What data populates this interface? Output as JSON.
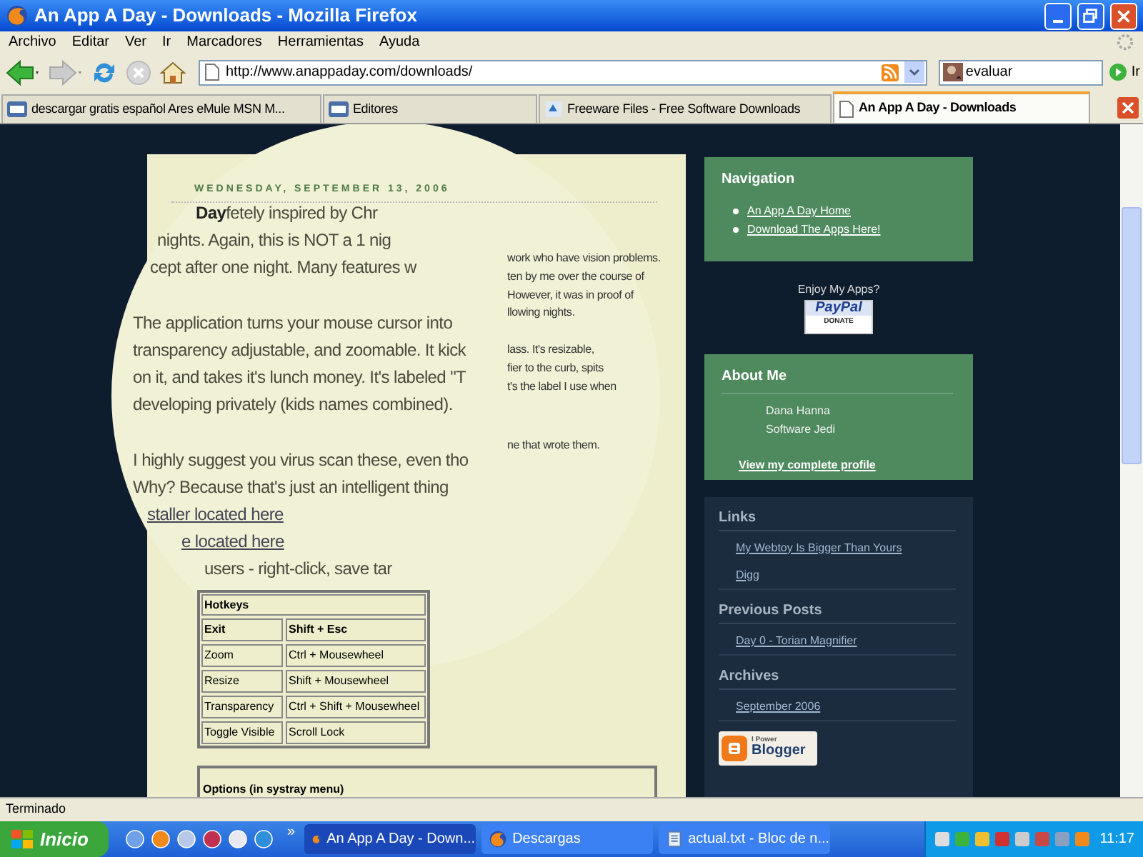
{
  "window": {
    "title": "An App A Day - Downloads - Mozilla Firefox"
  },
  "menu": [
    "Archivo",
    "Editar",
    "Ver",
    "Ir",
    "Marcadores",
    "Herramientas",
    "Ayuda"
  ],
  "toolbar": {
    "url": "http://www.anappaday.com/downloads/",
    "search_value": "evaluar",
    "go_label": "Ir"
  },
  "tabs": [
    {
      "label": "descargar gratis español Ares eMule MSN M...",
      "selected": false
    },
    {
      "label": "Editores",
      "selected": false
    },
    {
      "label": "Freeware Files - Free Software Downloads",
      "selected": false
    },
    {
      "label": "An App A Day - Downloads",
      "selected": true
    }
  ],
  "post": {
    "date": "WEDNESDAY, SEPTEMBER 13, 2006",
    "magnified_lines": [
      {
        "parts": [
          {
            "kind": "bold",
            "text": "Day"
          },
          {
            "kind": "text",
            "text": "fetely inspired by Chr"
          }
        ]
      },
      {
        "parts": [
          {
            "kind": "text",
            "text": "nights. Again, this is NOT a 1 nig"
          }
        ]
      },
      {
        "parts": [
          {
            "kind": "text",
            "text": "cept after one night. Many features w"
          }
        ]
      },
      {
        "parts": [
          {
            "kind": "text",
            "text": "The application turns your mouse cursor into"
          }
        ]
      },
      {
        "parts": [
          {
            "kind": "text",
            "text": "transparency adjustable, and zoomable. It kick"
          }
        ]
      },
      {
        "parts": [
          {
            "kind": "text",
            "text": "on it, and takes it's lunch money. It's labeled \"T"
          }
        ]
      },
      {
        "parts": [
          {
            "kind": "text",
            "text": "developing privately (kids names combined)."
          }
        ]
      },
      {
        "parts": [
          {
            "kind": "text",
            "text": "I highly suggest you virus scan these, even tho"
          }
        ]
      },
      {
        "parts": [
          {
            "kind": "text",
            "text": "Why? Because that's just an intelligent thing"
          }
        ]
      },
      {
        "parts": [
          {
            "kind": "link",
            "text": "staller located here"
          }
        ]
      },
      {
        "parts": [
          {
            "kind": "link",
            "text": "e located here"
          }
        ]
      },
      {
        "parts": [
          {
            "kind": "text",
            "text": "users - right-click, save tar"
          }
        ]
      }
    ],
    "notes": [
      "work who have vision problems.",
      "ten by me over the course of",
      "However, it was in proof of",
      "llowing nights.",
      "lass. It's resizable,",
      "fier to the curb, spits",
      "t's the label I use when",
      "ne that wrote them."
    ],
    "hotkeys": {
      "title": "Hotkeys",
      "rows": [
        {
          "cells": [
            "Exit",
            "Shift + Esc"
          ],
          "bold": true
        },
        {
          "cells": [
            "Zoom",
            "Ctrl + Mousewheel"
          ],
          "bold": false
        },
        {
          "cells": [
            "Resize",
            "Shift + Mousewheel"
          ],
          "bold": false
        },
        {
          "cells": [
            "Transparency",
            "Ctrl + Shift + Mousewheel"
          ],
          "bold": false
        },
        {
          "cells": [
            "Toggle Visible",
            "Scroll Lock"
          ],
          "bold": false
        }
      ]
    },
    "options_title": "Options (in systray menu)"
  },
  "sidebar": {
    "navigation": {
      "title": "Navigation",
      "links": [
        "An App A Day Home",
        "Download The Apps Here!"
      ]
    },
    "donate": {
      "prompt": "Enjoy My Apps?",
      "top": "PayPal",
      "bottom": "DONATE"
    },
    "about": {
      "title": "About Me",
      "name": "Dana Hanna",
      "role": "Software Jedi",
      "profile_link": "View my complete profile"
    },
    "sections": [
      {
        "title": "Links",
        "links": [
          "My Webtoy Is Bigger Than Yours",
          "Digg"
        ]
      },
      {
        "title": "Previous Posts",
        "links": [
          "Day 0 - Torian Magnifier"
        ]
      },
      {
        "title": "Archives",
        "links": [
          "September 2006"
        ]
      }
    ],
    "badge": {
      "top": "I Power",
      "bottom": "Blogger"
    }
  },
  "status_bar": "Terminado",
  "taskbar": {
    "start": "Inicio",
    "more": "»",
    "tasks": [
      {
        "label": "An App A Day - Down...",
        "selected": true
      },
      {
        "label": "Descargas",
        "selected": false
      },
      {
        "label": "actual.txt - Bloc de n...",
        "selected": false
      }
    ],
    "clock": "11:17"
  }
}
